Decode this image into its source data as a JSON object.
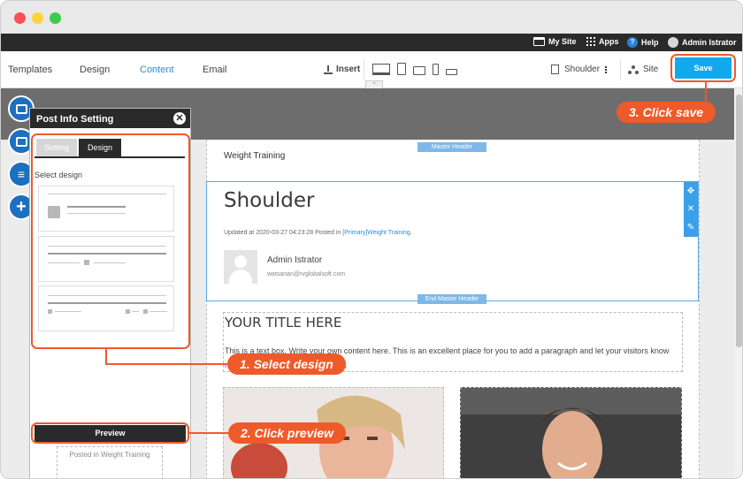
{
  "admin_bar": {
    "my_site": "My Site",
    "apps": "Apps",
    "help": "Help",
    "user": "Admin Istrator"
  },
  "toolbar": {
    "tabs": [
      "Templates",
      "Design",
      "Content",
      "Email"
    ],
    "active_tab": "Content",
    "insert_label": "Insert",
    "page_name": "Shoulder",
    "site_label": "Site",
    "save_label": "Save"
  },
  "panel": {
    "title": "Post Info Setting",
    "tabs": [
      "Setting",
      "Design"
    ],
    "active_tab": "Design",
    "select_label": "Select design",
    "preview_label": "Preview",
    "underlay_text": "Posted in Weight Training"
  },
  "page": {
    "site_title": "Weight Training",
    "master_header_label": "Master Header",
    "end_master_header_label": "End Master Header",
    "post_title": "Shoulder",
    "post_meta_prefix": "Updated at 2020-03-27 04:23:28 Posted in ",
    "post_meta_category": "[Primary]Weight Training",
    "post_meta_suffix": ".",
    "author_name": "Admin Istrator",
    "author_email": "watsanan@rvglobalsoft.com",
    "text_title": "YOUR TITLE HERE",
    "text_body": "This is a text box. Write your own content here. This is an excellent place for you to add a paragraph and let your visitors know more about you and your services."
  },
  "callouts": {
    "step1": "1. Select design",
    "step2": "2. Click preview",
    "step3": "3. Click save"
  },
  "colors": {
    "accent": "#ef5a2a",
    "save_blue": "#12a8ee",
    "admin_bar": "#2a2a2a",
    "active_tab": "#2a8ad6"
  }
}
